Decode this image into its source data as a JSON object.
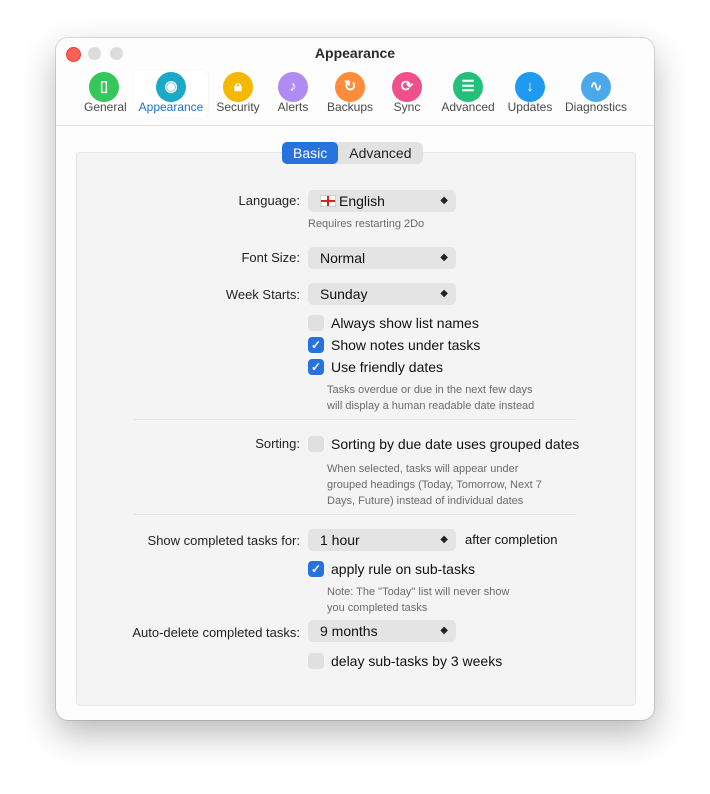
{
  "window": {
    "title": "Appearance"
  },
  "toolbar": {
    "items": [
      {
        "label": "General",
        "icon": "general-icon",
        "color": "#34c759"
      },
      {
        "label": "Appearance",
        "icon": "palette-icon",
        "color": "#1aa9c6"
      },
      {
        "label": "Security",
        "icon": "lock-icon",
        "color": "#f5b800"
      },
      {
        "label": "Alerts",
        "icon": "bell-icon",
        "color": "#b08cf2"
      },
      {
        "label": "Backups",
        "icon": "refresh-icon",
        "color": "#ff8c3a"
      },
      {
        "label": "Sync",
        "icon": "sync-icon",
        "color": "#f0508a"
      },
      {
        "label": "Advanced",
        "icon": "sliders-icon",
        "color": "#22c07a"
      },
      {
        "label": "Updates",
        "icon": "download-icon",
        "color": "#1e9bf0"
      },
      {
        "label": "Diagnostics",
        "icon": "pulse-icon",
        "color": "#4aa9ea"
      }
    ],
    "selected": "Appearance"
  },
  "tabs": {
    "basic": "Basic",
    "advanced": "Advanced",
    "selected": "Basic"
  },
  "language": {
    "label": "Language:",
    "value": "English",
    "hint": "Requires restarting 2Do"
  },
  "font_size": {
    "label": "Font Size:",
    "value": "Normal"
  },
  "week_starts": {
    "label": "Week Starts:",
    "value": "Sunday"
  },
  "options": {
    "always_show_list_names": {
      "label": "Always show list names",
      "checked": false
    },
    "show_notes_under_tasks": {
      "label": "Show notes under tasks",
      "checked": true
    },
    "use_friendly_dates": {
      "label": "Use friendly dates",
      "checked": true
    },
    "friendly_hint_1": "Tasks overdue or due in the next few days",
    "friendly_hint_2": "will display a human readable date instead"
  },
  "sorting": {
    "label": "Sorting:",
    "option": {
      "label": "Sorting by due date uses grouped dates",
      "checked": false
    },
    "hint_1": "When selected, tasks will appear under",
    "hint_2": "grouped headings (Today, Tomorrow, Next 7",
    "hint_3": "Days, Future) instead of individual dates"
  },
  "completed": {
    "label": "Show completed tasks for:",
    "value": "1 hour",
    "suffix": "after completion",
    "apply_rule": {
      "label": "apply rule on sub-tasks",
      "checked": true
    },
    "note_1": "Note: The \"Today\" list will never show",
    "note_2": "you completed tasks"
  },
  "auto_delete": {
    "label": "Auto-delete completed tasks:",
    "value": "9 months",
    "delay": {
      "label": "delay sub-tasks by 3 weeks",
      "checked": false
    }
  },
  "accent_color": "#2673e0"
}
